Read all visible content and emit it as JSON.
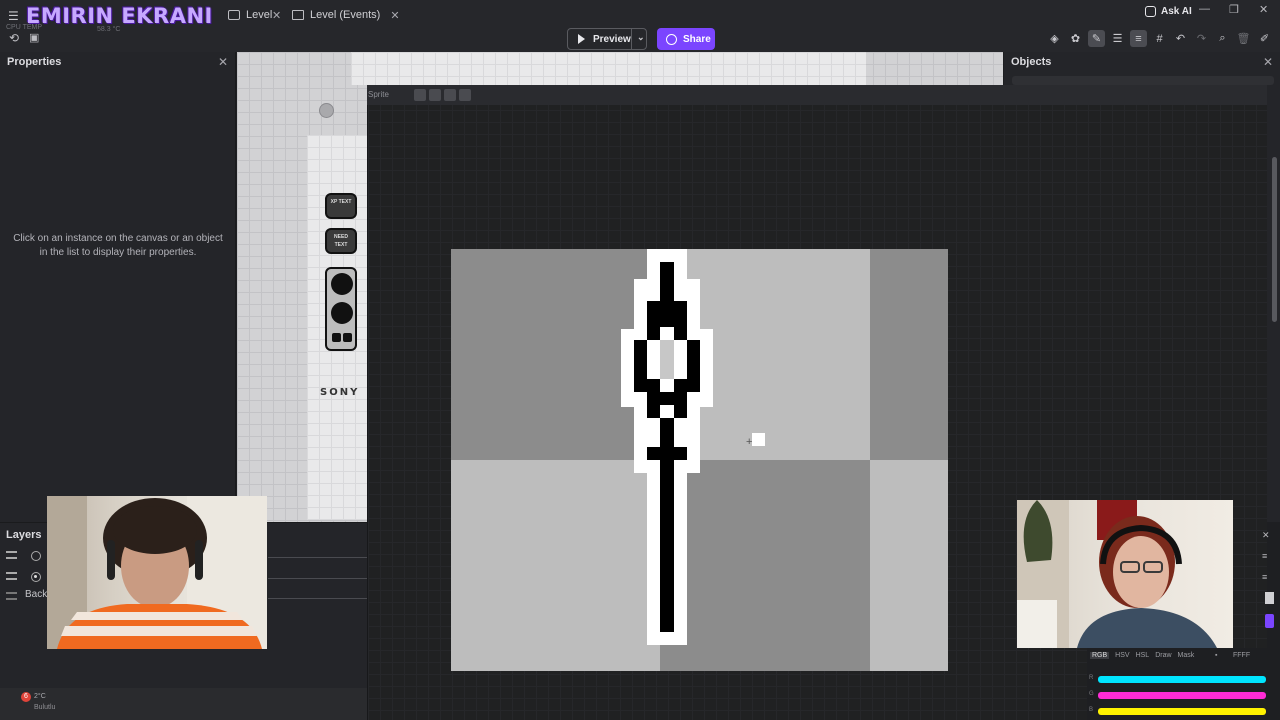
{
  "overlay": {
    "brand": "EMIRIN EKRANI",
    "cpu_temp": "58.3 °C",
    "cpu_label": "CPU TEMP"
  },
  "tabs": [
    {
      "label": "Level",
      "active": true
    },
    {
      "label": "Level (Events)",
      "active": false
    }
  ],
  "toolbar": {
    "preview_label": "Preview",
    "share_label": "Share",
    "ask_ai_label": "Ask AI",
    "accent": "#7b45ff"
  },
  "properties_panel": {
    "title": "Properties",
    "hint": "Click on an instance on the canvas or an object in the list to display their properties."
  },
  "objects_panel": {
    "title": "Objects"
  },
  "layers_panel": {
    "title": "Layers",
    "rows": [
      {
        "label": ""
      },
      {
        "label": ""
      },
      {
        "label": "Back"
      }
    ]
  },
  "canvas": {
    "hud_buttons": [
      {
        "label": "XP TEXT"
      },
      {
        "label": "NEED TEXT"
      }
    ],
    "brand_text": "SONY"
  },
  "sprite_editor": {
    "title": "Sprite"
  },
  "color_picker": {
    "tabs": [
      "RGB",
      "HSV",
      "HSL",
      "Draw",
      "Mask"
    ],
    "hex_label": "FFFF",
    "sliders": [
      {
        "label": "R",
        "color": "#00e5ff"
      },
      {
        "label": "G",
        "color": "#ff2bd6"
      },
      {
        "label": "B",
        "color": "#fff200"
      }
    ]
  },
  "taskbar": {
    "weather_temp": "2°C",
    "weather_desc": "Bulutlu",
    "notification_count": "6"
  }
}
